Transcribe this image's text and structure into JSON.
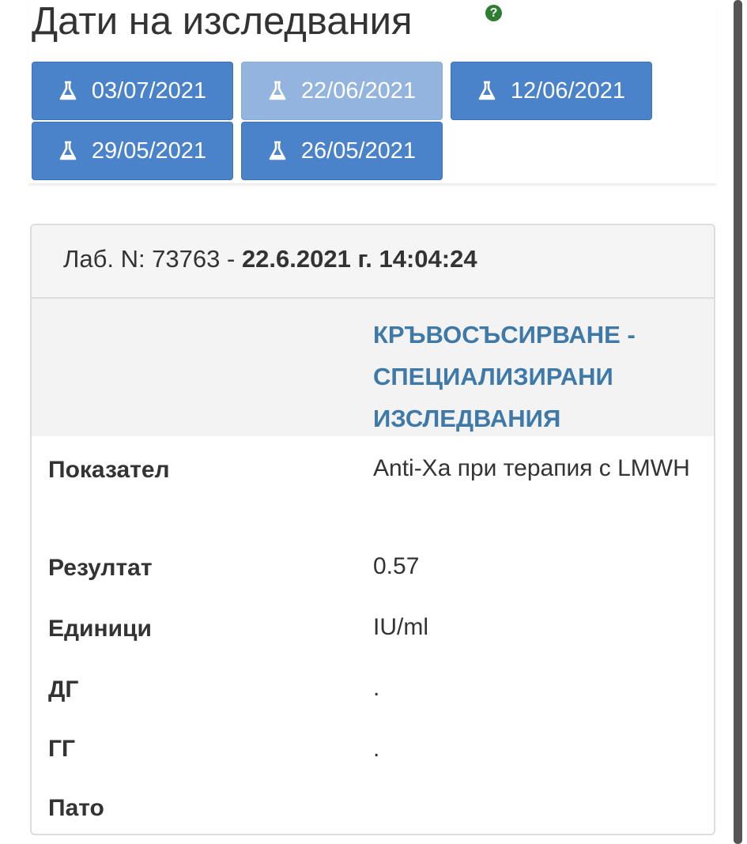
{
  "page": {
    "title": "Дати на изследвания",
    "help_icon": "question-circle-icon"
  },
  "accent_colors": {
    "button": "#4a83c9",
    "button_active": "#93b4de",
    "section_title": "#3f79a8",
    "help_icon": "#2e7d32"
  },
  "date_buttons": {
    "icon": "flask-icon",
    "items": [
      {
        "label": "03/07/2021",
        "active": false
      },
      {
        "label": "22/06/2021",
        "active": true
      },
      {
        "label": "12/06/2021",
        "active": false
      },
      {
        "label": "29/05/2021",
        "active": false
      },
      {
        "label": "26/05/2021",
        "active": false
      }
    ]
  },
  "lab": {
    "number_prefix": "Лаб. N: 73763 - ",
    "datetime": "22.6.2021 г. 14:04:24",
    "section_title": "КРЪВОСЪСИРВАНЕ - СПЕЦИАЛИЗИРАНИ ИЗСЛЕДВАНИЯ",
    "rows": [
      {
        "label": "Показател",
        "value": "Anti-Xa при терапия с LMWH"
      },
      {
        "label": "Резултат",
        "value": "0.57"
      },
      {
        "label": "Единици",
        "value": "IU/ml"
      },
      {
        "label": "ДГ",
        "value": "."
      },
      {
        "label": "ГГ",
        "value": "."
      },
      {
        "label": "Пато",
        "value": ""
      }
    ]
  }
}
